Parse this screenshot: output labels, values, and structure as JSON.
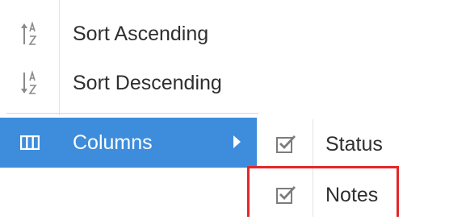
{
  "menu": {
    "items": [
      {
        "label": "Sort Ascending",
        "icon": "sort-ascending-icon"
      },
      {
        "label": "Sort Descending",
        "icon": "sort-descending-icon"
      },
      {
        "label": "Columns",
        "icon": "columns-icon",
        "highlighted": true,
        "has_submenu": true
      }
    ],
    "highlight_color": "#3d8ddc"
  },
  "submenu": {
    "items": [
      {
        "label": "Status",
        "checked": true,
        "icon": "checkbox-checked-icon"
      },
      {
        "label": "Notes",
        "checked": true,
        "icon": "checkbox-checked-icon",
        "annotated": true
      }
    ]
  },
  "annotation_color": "#e32727"
}
